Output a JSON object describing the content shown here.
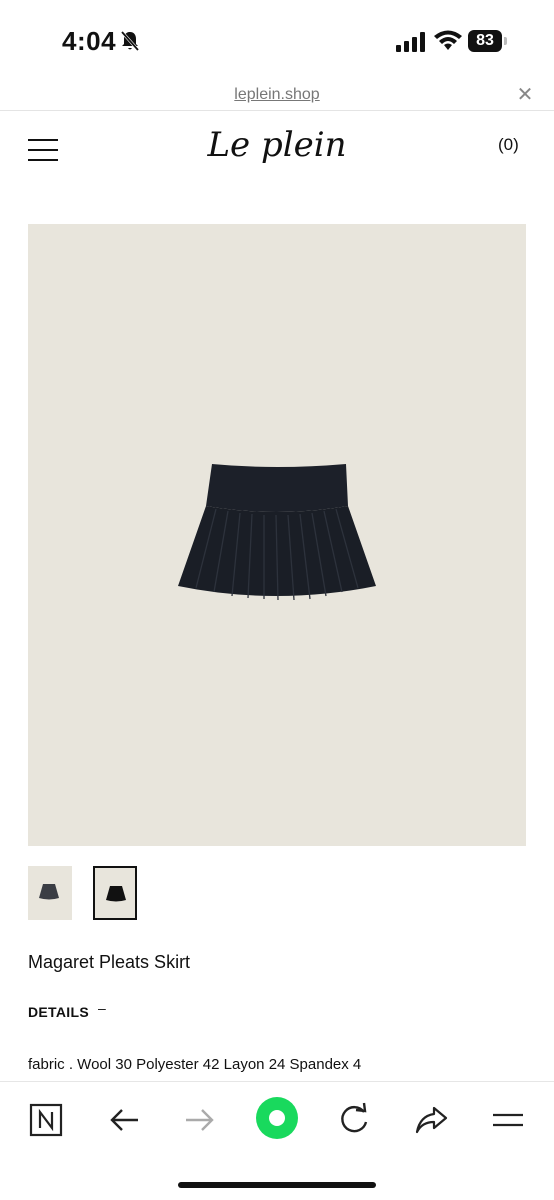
{
  "status_bar": {
    "time": "4:04",
    "battery": "83"
  },
  "url_bar": {
    "url": "leplein.shop",
    "close_label": "✕"
  },
  "header": {
    "logo_text": "Le plein",
    "cart_label": "(0)"
  },
  "product": {
    "name": "Magaret Pleats Skirt",
    "details_label": "DETAILS",
    "details_toggle": "–",
    "fabric": "fabric . Wool 30 Polyester 42 Layon 24 Spandex 4"
  },
  "colors": {
    "image_bg": "#e8e5dc",
    "skirt": "#1b1f27",
    "home_button": "#19d95d"
  },
  "toolbar": {
    "icons": [
      "naver-n-icon",
      "back-arrow-icon",
      "forward-arrow-icon",
      "home-circle-icon",
      "reload-icon",
      "share-icon",
      "menu-icon"
    ]
  }
}
